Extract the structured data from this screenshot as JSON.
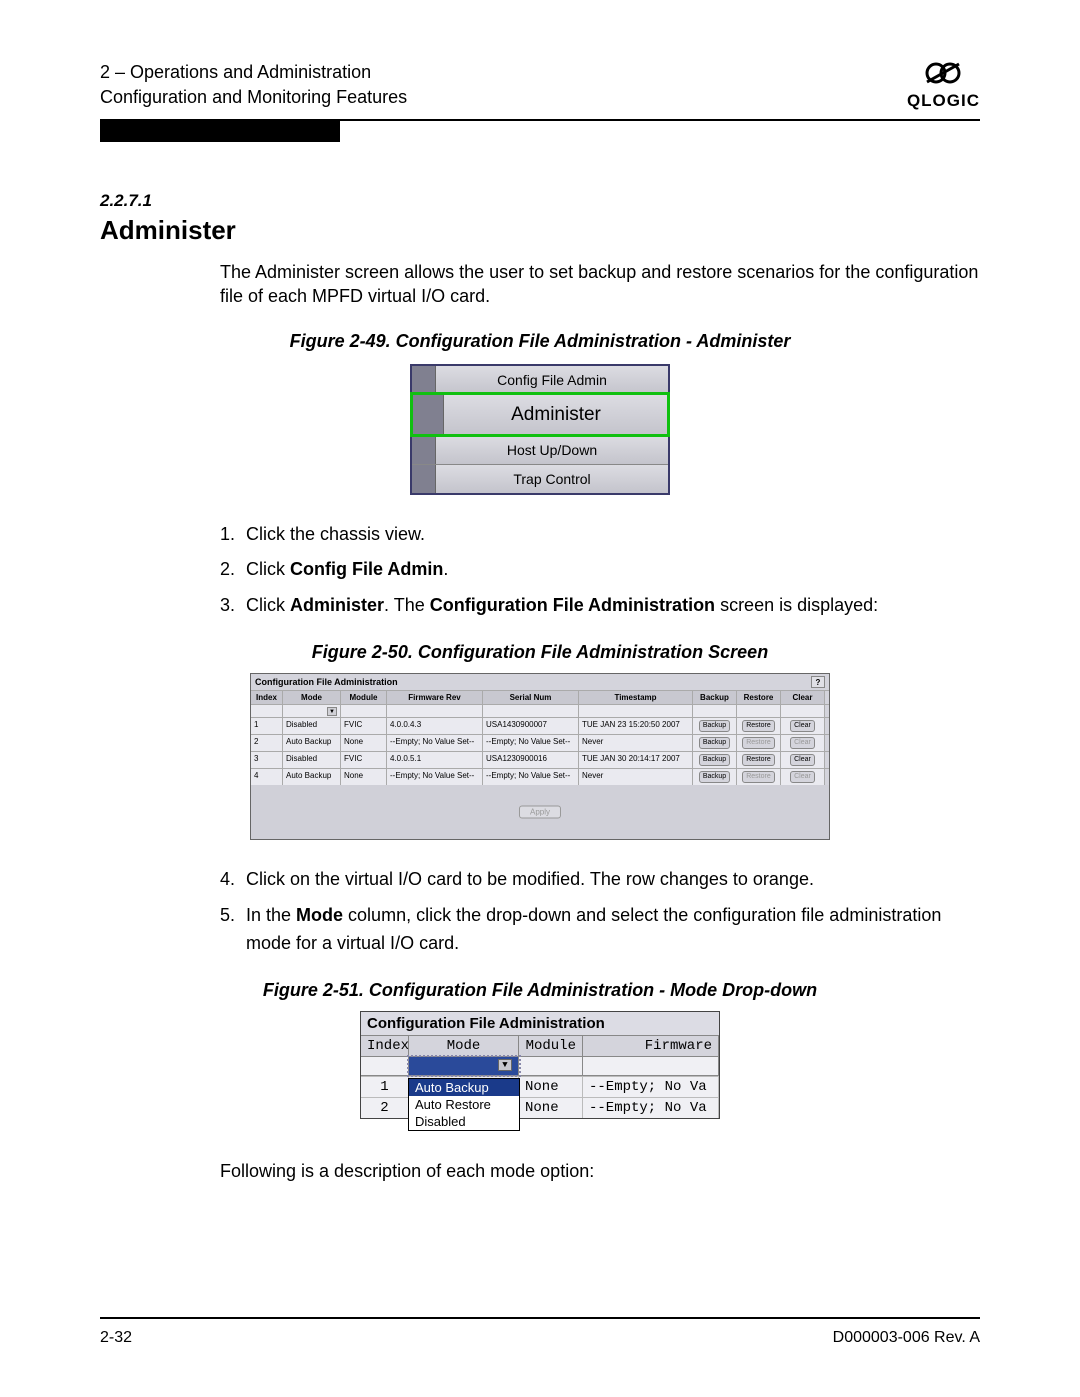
{
  "header": {
    "line1": "2 – Operations and Administration",
    "line2": "Configuration and Monitoring Features",
    "brand": "QLOGIC"
  },
  "section_number": "2.2.7.1",
  "section_title": "Administer",
  "intro": "The Administer screen allows the user to set backup and restore scenarios for the configuration file of each MPFD virtual I/O card.",
  "fig49": {
    "caption": "Figure 2-49. Configuration File Administration - Administer",
    "items": [
      "Config File Admin",
      "Administer",
      "Host Up/Down",
      "Trap Control"
    ]
  },
  "steps_a": {
    "s1": "Click the chassis view.",
    "s2_prefix": "Click ",
    "s2_bold": "Config File Admin",
    "s2_suffix": ".",
    "s3_prefix": "Click ",
    "s3_bold1": "Administer",
    "s3_mid": ". The ",
    "s3_bold2": "Configuration File Administration",
    "s3_suffix": " screen is displayed:"
  },
  "fig50": {
    "caption": "Figure 2-50. Configuration File Administration Screen",
    "title": "Configuration File Administration",
    "help": "?",
    "headers": {
      "idx": "Index",
      "mode": "Mode",
      "mod": "Module",
      "fw": "Firmware Rev",
      "sn": "Serial Num",
      "ts": "Timestamp",
      "bk": "Backup",
      "rs": "Restore",
      "cl": "Clear"
    },
    "rows": [
      {
        "idx": "1",
        "mode": "Disabled",
        "mod": "FVIC",
        "fw": "4.0.0.4.3",
        "sn": "USA1430900007",
        "ts": "TUE JAN 23 15:20:50 2007",
        "bk": "Backup",
        "rs": "Restore",
        "rs_dis": false,
        "cl": "Clear",
        "cl_dis": false
      },
      {
        "idx": "2",
        "mode": "Auto Backup",
        "mod": "None",
        "fw": "--Empty; No Value Set--",
        "sn": "--Empty; No Value Set--",
        "ts": "Never",
        "bk": "Backup",
        "rs": "Restore",
        "rs_dis": true,
        "cl": "Clear",
        "cl_dis": true
      },
      {
        "idx": "3",
        "mode": "Disabled",
        "mod": "FVIC",
        "fw": "4.0.0.5.1",
        "sn": "USA1230900016",
        "ts": "TUE JAN 30 20:14:17 2007",
        "bk": "Backup",
        "rs": "Restore",
        "rs_dis": false,
        "cl": "Clear",
        "cl_dis": false
      },
      {
        "idx": "4",
        "mode": "Auto Backup",
        "mod": "None",
        "fw": "--Empty; No Value Set--",
        "sn": "--Empty; No Value Set--",
        "ts": "Never",
        "bk": "Backup",
        "rs": "Restore",
        "rs_dis": true,
        "cl": "Clear",
        "cl_dis": true
      }
    ],
    "apply": "Apply"
  },
  "steps_b": {
    "s4": "Click on the virtual I/O card to be modified. The row changes to orange.",
    "s5_prefix": "In the ",
    "s5_bold": "Mode",
    "s5_suffix": " column, click the drop-down and select the configuration file administration mode for a virtual I/O card."
  },
  "fig51": {
    "caption": "Figure 2-51. Configuration File Administration - Mode Drop-down",
    "title": "Configuration File Administration",
    "headers": {
      "idx": "Index",
      "mode": "Mode",
      "mod": "Module",
      "fw": "Firmware"
    },
    "rows": [
      {
        "idx": "1",
        "mod": "None",
        "fw": "--Empty; No Va"
      },
      {
        "idx": "2",
        "mod": "None",
        "fw": "--Empty; No Va"
      }
    ],
    "options": [
      "Auto Backup",
      "Auto Restore",
      "Disabled"
    ]
  },
  "outro": "Following is a description of each mode option:",
  "footer": {
    "left": "2-32",
    "right": "D000003-006 Rev. A"
  }
}
